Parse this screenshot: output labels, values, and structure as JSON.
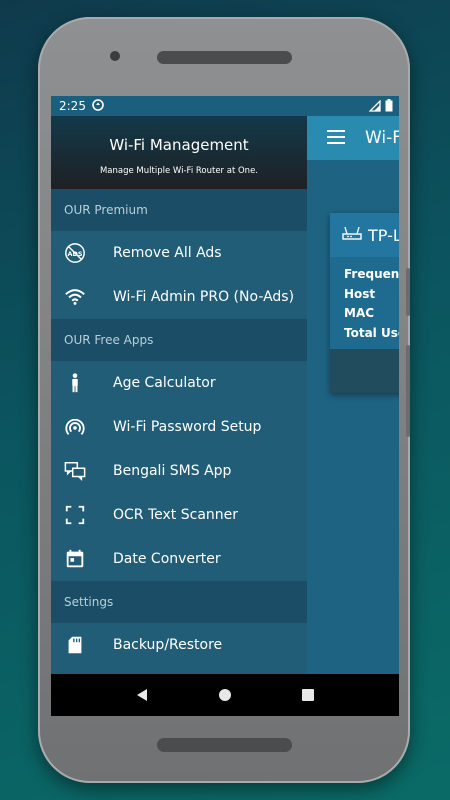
{
  "status": {
    "time": "2:25"
  },
  "app": {
    "title": "Wi-Fi"
  },
  "card": {
    "title": "TP-L",
    "rows": [
      "Frequency",
      "Host",
      "MAC",
      "Total User"
    ]
  },
  "drawer": {
    "header": {
      "title": "Wi-Fi Management",
      "subtitle": "Manage Multiple Wi-Fi Router at One."
    },
    "sections": [
      {
        "label": "OUR Premium",
        "items": [
          {
            "label": "Remove All Ads",
            "icon": "no-ads-icon"
          },
          {
            "label": "Wi-Fi Admin PRO (No-Ads)",
            "icon": "wifi-icon"
          }
        ]
      },
      {
        "label": "OUR Free Apps",
        "items": [
          {
            "label": "Age Calculator",
            "icon": "person-icon"
          },
          {
            "label": "Wi-Fi Password Setup",
            "icon": "hotspot-icon"
          },
          {
            "label": "Bengali SMS App",
            "icon": "chat-icon"
          },
          {
            "label": "OCR Text Scanner",
            "icon": "scan-icon"
          },
          {
            "label": "Date Converter",
            "icon": "calendar-icon"
          }
        ]
      },
      {
        "label": "Settings",
        "items": [
          {
            "label": "Backup/Restore",
            "icon": "sd-card-icon"
          }
        ]
      }
    ]
  }
}
